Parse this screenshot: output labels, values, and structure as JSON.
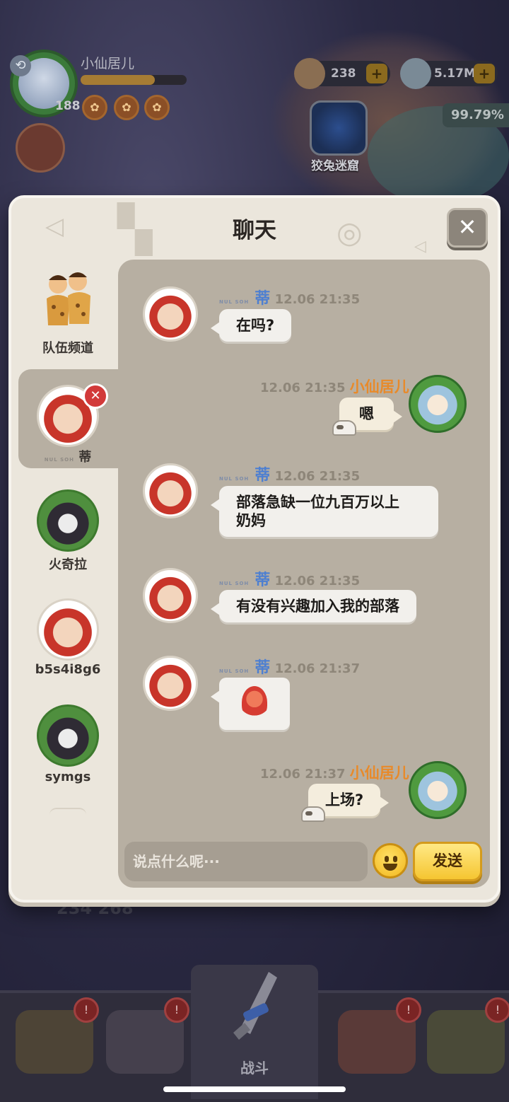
{
  "hud": {
    "player_name": "小仙居儿",
    "player_level": "188",
    "xp_progress": 0.7,
    "resource_1": "238",
    "resource_2": "5.17M",
    "progress_percent": "99.79%",
    "maze_label": "狡兔迷窟",
    "score": "234 268"
  },
  "chat": {
    "title": "聊天",
    "close_symbol": "✕",
    "sidebar": [
      {
        "label": "队伍频道",
        "icon": "caveman-team-icon"
      },
      {
        "label": "蒂",
        "icon": "red-hair-avatar",
        "active": true,
        "tags": "NUL SOH"
      },
      {
        "label": "火奇拉",
        "icon": "skull-avatar"
      },
      {
        "label": "b5s4i8g6",
        "icon": "red-hair-avatar"
      },
      {
        "label": "symgs",
        "icon": "skull-avatar"
      }
    ],
    "messages": [
      {
        "sender": "蒂",
        "tags": "NUL SOH",
        "time": "12.06 21:35",
        "text": "在吗?",
        "self": false
      },
      {
        "sender": "小仙居儿",
        "time": "12.06 21:35",
        "text": "嗯",
        "self": true
      },
      {
        "sender": "蒂",
        "tags": "NUL SOH",
        "time": "12.06 21:35",
        "text_line1": "部落急缺一位九百万以上",
        "text_line2": "奶妈",
        "self": false
      },
      {
        "sender": "蒂",
        "tags": "NUL SOH",
        "time": "12.06 21:35",
        "text": "有没有兴趣加入我的部落",
        "self": false
      },
      {
        "sender": "蒂",
        "tags": "NUL SOH",
        "time": "12.06 21:37",
        "sticker": "red-dragon-sticker",
        "self": false
      },
      {
        "sender": "小仙居儿",
        "time": "12.06 21:37",
        "text": "上场?",
        "self": true
      }
    ],
    "input_placeholder": "说点什么呢···",
    "send_label": "发送"
  },
  "nav": {
    "battle_label": "战斗",
    "alert_symbol": "!"
  },
  "colors": {
    "modal_bg": "#ebe6dc",
    "chat_area": "#b7afa2",
    "other_name": "#4d7fd1",
    "self_name": "#e88a2a",
    "send_button": "#f5c531"
  }
}
